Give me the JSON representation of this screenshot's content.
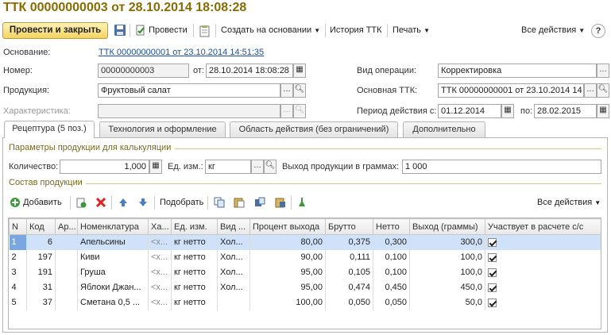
{
  "window": {
    "title": "ТТК 00000000003 от 28.10.2014 18:08:28"
  },
  "toolbar": {
    "post_close": "Провести и закрыть",
    "post": "Провести",
    "create_based": "Создать на основании",
    "history": "История ТТК",
    "print": "Печать",
    "all_actions": "Все действия",
    "help": "?"
  },
  "form": {
    "basis_label": "Основание:",
    "basis_link": "ТТК 00000000001 от 23.10.2014 14:51:35",
    "number_label": "Номер:",
    "number_value": "00000000003",
    "from_label": "от:",
    "date_value": "28.10.2014 18:08:28",
    "operation_label": "Вид операции:",
    "operation_value": "Корректировка",
    "product_label": "Продукция:",
    "product_value": "Фруктовый салат",
    "main_ttk_label": "Основная ТТК:",
    "main_ttk_value": "ТТК 00000000001 от 23.10.2014 14",
    "characteristic_label": "Характеристика:",
    "characteristic_value": "",
    "period_label": "Период действия с:",
    "period_from": "01.12.2014",
    "period_to_label": "по:",
    "period_to": "28.02.2015"
  },
  "tabs": [
    {
      "label": "Рецептура (5 поз.)"
    },
    {
      "label": "Технология и оформление"
    },
    {
      "label": "Область действия (без ограничений)"
    },
    {
      "label": "Дополнительно"
    }
  ],
  "params": {
    "group_title": "Параметры продукции для калькуляции",
    "qty_label": "Количество:",
    "qty_value": "1,000",
    "unit_label": "Ед. изм.:",
    "unit_value": "кг",
    "yield_label": "Выход продукции в граммах:",
    "yield_value": "1 000"
  },
  "composition": {
    "group_title": "Состав продукции",
    "add": "Добавить",
    "pick": "Подобрать",
    "all_actions": "Все действия"
  },
  "table": {
    "headers": [
      "N",
      "Код",
      "Ар...",
      "Номенклатура",
      "Ха...",
      "Ед. изм.",
      "Вид ...",
      "Процент выхода",
      "Брутто",
      "Нетто",
      "Выход (граммы)",
      "Участвует в расчете с/с"
    ],
    "rows": [
      [
        "1",
        "6",
        "",
        "Апельсины",
        "<х...",
        "кг нетто",
        "Хол...",
        "80,00",
        "0,375",
        "0,300",
        "300,0"
      ],
      [
        "2",
        "197",
        "",
        "Киви",
        "<х...",
        "кг нетто",
        "Хол...",
        "90,00",
        "0,111",
        "0,100",
        "100,0"
      ],
      [
        "3",
        "191",
        "",
        "Груша",
        "<х...",
        "кг нетто",
        "Хол...",
        "95,00",
        "0,105",
        "0,100",
        "100,0"
      ],
      [
        "4",
        "31",
        "",
        "Яблоки Джан...",
        "<х...",
        "кг нетто",
        "Хол...",
        "95,00",
        "0,474",
        "0,450",
        "450,0"
      ],
      [
        "5",
        "37",
        "",
        "Сметана 0,5 ...",
        "<х...",
        "кг нетто",
        "",
        "100,00",
        "0,050",
        "0,050",
        "50,0"
      ]
    ]
  },
  "colors": {
    "title": "#8a6b00",
    "primary_button": "#f4d35f",
    "selection": "#cfe2f9"
  }
}
